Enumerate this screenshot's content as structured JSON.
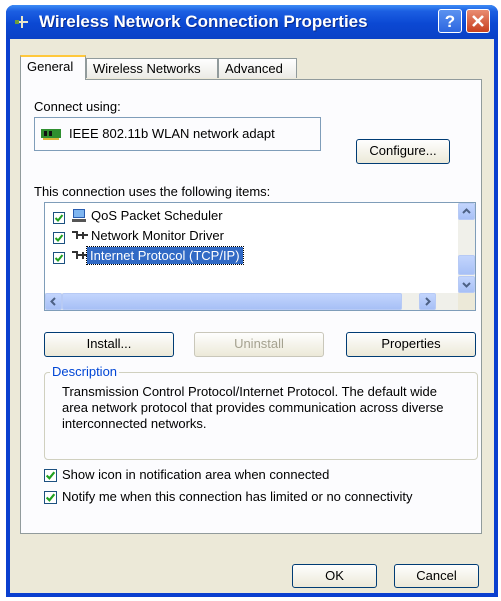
{
  "window": {
    "title": "Wireless Network Connection Properties"
  },
  "tabs": [
    {
      "label": "General"
    },
    {
      "label": "Wireless Networks"
    },
    {
      "label": "Advanced"
    }
  ],
  "general": {
    "connect_using_label": "Connect using:",
    "adapter_name": "IEEE 802.11b WLAN network adapt",
    "configure_button": "Configure...",
    "items_label": "This connection uses the following items:",
    "items": [
      {
        "label": "QoS Packet Scheduler",
        "checked": true,
        "icon": "qos-icon"
      },
      {
        "label": "Network Monitor Driver",
        "checked": true,
        "icon": "network-protocol-icon"
      },
      {
        "label": "Internet Protocol (TCP/IP)",
        "checked": true,
        "icon": "network-protocol-icon",
        "selected": true
      }
    ],
    "install_button": "Install...",
    "uninstall_button": "Uninstall",
    "properties_button": "Properties",
    "description_title": "Description",
    "description_text": "Transmission Control Protocol/Internet Protocol. The default wide area network protocol that provides communication across diverse interconnected networks.",
    "show_icon_label": "Show icon in notification area when connected",
    "show_icon_checked": true,
    "notify_label": "Notify me when this connection has limited or no connectivity",
    "notify_checked": true
  },
  "footer": {
    "ok_button": "OK",
    "cancel_button": "Cancel"
  },
  "colors": {
    "titlebar": "#0b48d3",
    "selection": "#316ac5",
    "dialog_bg": "#ece9d8"
  }
}
